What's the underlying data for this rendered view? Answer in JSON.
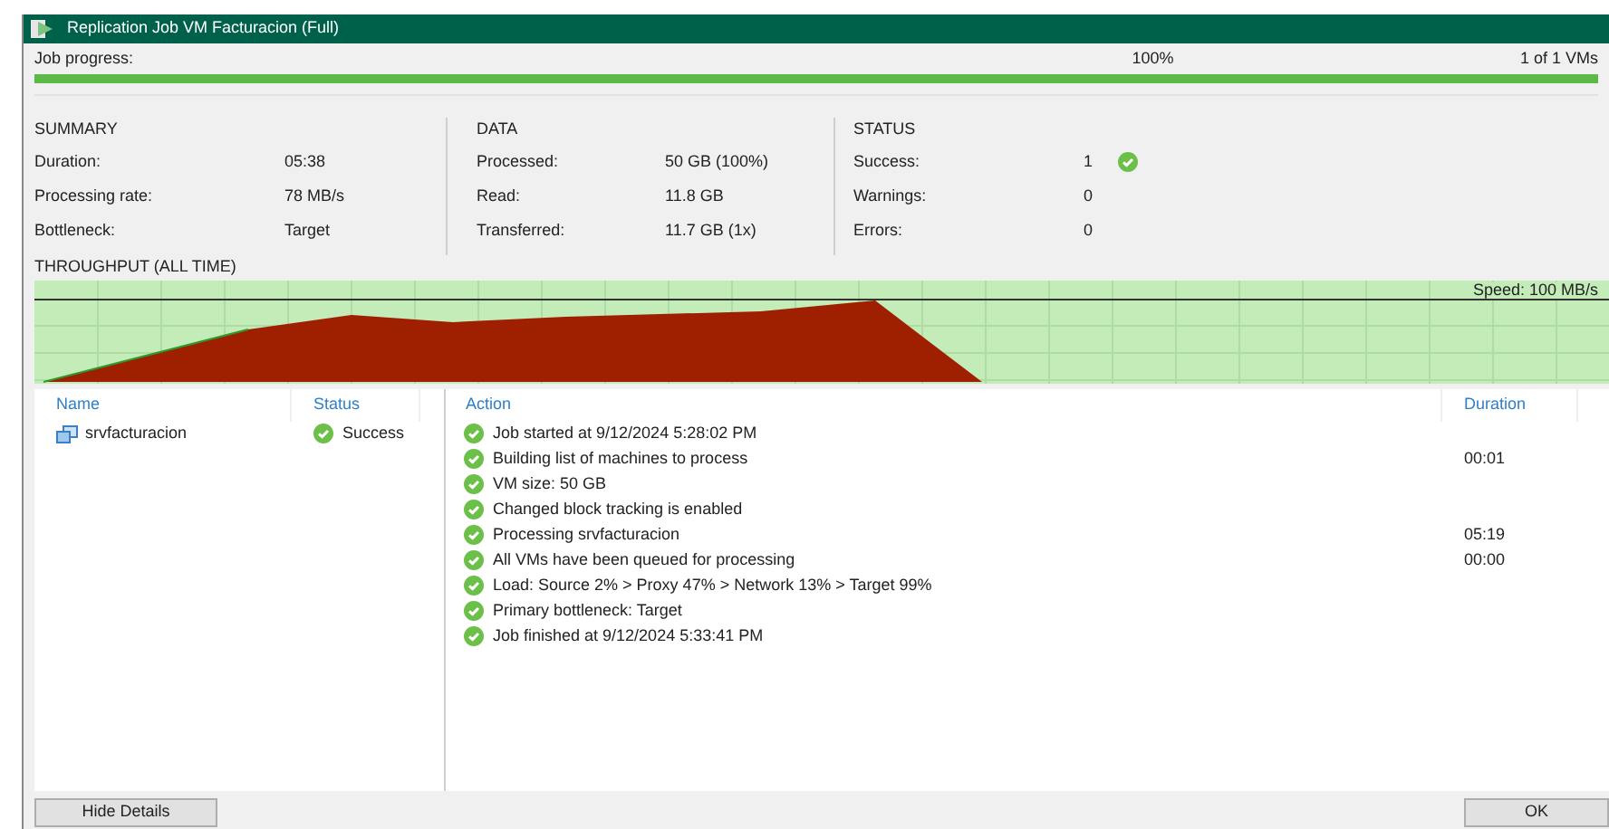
{
  "window": {
    "title": "Replication Job VM Facturacion (Full)"
  },
  "progress": {
    "label": "Job progress:",
    "percent": "100%",
    "count": "1 of 1 VMs",
    "level": 1
  },
  "summary": {
    "title": "SUMMARY",
    "rows": [
      {
        "label": "Duration:",
        "value": "05:38"
      },
      {
        "label": "Processing rate:",
        "value": "78 MB/s"
      },
      {
        "label": "Bottleneck:",
        "value": "Target"
      }
    ]
  },
  "data": {
    "title": "DATA",
    "rows": [
      {
        "label": "Processed:",
        "value": "50 GB (100%)"
      },
      {
        "label": "Read:",
        "value": "11.8 GB"
      },
      {
        "label": "Transferred:",
        "value": "11.7 GB (1x)"
      }
    ]
  },
  "status": {
    "title": "STATUS",
    "rows": [
      {
        "label": "Success:",
        "value": "1",
        "kind": "success"
      },
      {
        "label": "Warnings:",
        "value": "0",
        "kind": "plain"
      },
      {
        "label": "Errors:",
        "value": "0",
        "kind": "plain"
      }
    ]
  },
  "throughput": {
    "title": "THROUGHPUT (ALL TIME)",
    "speed": "Speed: 100 MB/s"
  },
  "vm_list": {
    "columns": [
      "Name",
      "Status"
    ],
    "rows": [
      {
        "name": "srvfacturacion",
        "status": "Success",
        "kind": "success"
      }
    ]
  },
  "log": {
    "columns": [
      "Action",
      "Duration"
    ],
    "rows": [
      {
        "action": "Job started at 9/12/2024 5:28:02 PM",
        "kind": "success"
      },
      {
        "action": "Building list of machines to process",
        "duration": "00:01",
        "kind": "success"
      },
      {
        "action": "VM size: 50 GB",
        "kind": "success"
      },
      {
        "action": "Changed block tracking is enabled",
        "kind": "success"
      },
      {
        "action": "Processing srvfacturacion",
        "duration": "05:19",
        "kind": "success"
      },
      {
        "action": "All VMs have been queued for processing",
        "duration": "00:00",
        "kind": "success"
      },
      {
        "action": "Load: Source 2% > Proxy 47% > Network 13% > Target 99%",
        "kind": "success"
      },
      {
        "action": "Primary bottleneck: Target",
        "kind": "success"
      },
      {
        "action": "Job finished at 9/12/2024 5:33:41 PM",
        "kind": "success"
      }
    ]
  },
  "buttons": [
    "Hide Details",
    "OK"
  ]
}
